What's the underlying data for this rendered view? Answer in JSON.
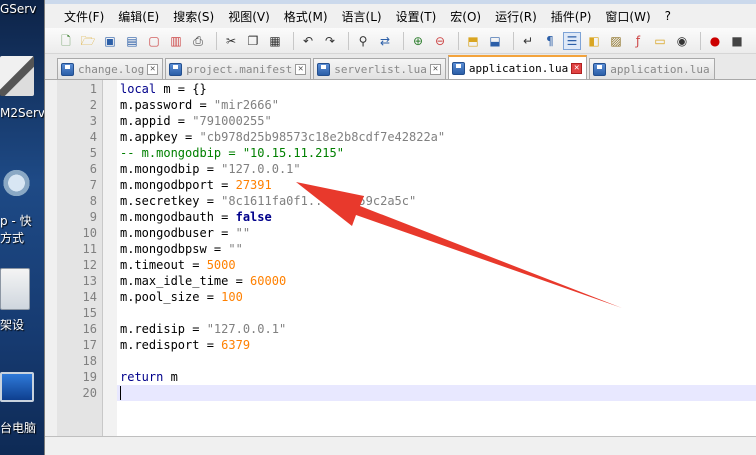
{
  "desktop": {
    "items": [
      {
        "label": "GServ"
      },
      {
        "label": "M2Serv"
      },
      {
        "label": "p - 快"
      },
      {
        "label": "方式"
      },
      {
        "label": "架设"
      },
      {
        "label": "台电脑"
      }
    ]
  },
  "menu": [
    {
      "label": "文件(F)"
    },
    {
      "label": "编辑(E)"
    },
    {
      "label": "搜索(S)"
    },
    {
      "label": "视图(V)"
    },
    {
      "label": "格式(M)"
    },
    {
      "label": "语言(L)"
    },
    {
      "label": "设置(T)"
    },
    {
      "label": "宏(O)"
    },
    {
      "label": "运行(R)"
    },
    {
      "label": "插件(P)"
    },
    {
      "label": "窗口(W)"
    },
    {
      "label": "?"
    }
  ],
  "toolbar": {
    "icons": [
      "new-file",
      "open-file",
      "save",
      "save-all",
      "close",
      "close-all",
      "print",
      "cut",
      "copy",
      "paste",
      "undo",
      "redo",
      "find",
      "replace",
      "zoom-in",
      "zoom-out",
      "sync-vertical",
      "sync-horizontal",
      "word-wrap",
      "show-all-chars",
      "indent-guide",
      "user-lang",
      "doc-map",
      "function-list",
      "monitor",
      "record-macro",
      "stop-record"
    ]
  },
  "tabs": [
    {
      "label": "change.log",
      "active": false
    },
    {
      "label": "project.manifest",
      "active": false
    },
    {
      "label": "serverlist.lua",
      "active": false
    },
    {
      "label": "application.lua",
      "active": true
    },
    {
      "label": "application.lua",
      "active": false
    }
  ],
  "editor": {
    "line_numbers": [
      "1",
      "2",
      "3",
      "4",
      "5",
      "6",
      "7",
      "8",
      "9",
      "10",
      "11",
      "12",
      "13",
      "14",
      "15",
      "16",
      "17",
      "18",
      "19",
      "20"
    ],
    "current_line": 20,
    "lines": [
      [
        {
          "t": "kw",
          "v": "local"
        },
        {
          "t": "plain",
          "v": " m = {}"
        }
      ],
      [
        {
          "t": "plain",
          "v": "m.password = "
        },
        {
          "t": "str",
          "v": "\"mir2666\""
        }
      ],
      [
        {
          "t": "plain",
          "v": "m.appid = "
        },
        {
          "t": "str",
          "v": "\"791000255\""
        }
      ],
      [
        {
          "t": "plain",
          "v": "m.appkey = "
        },
        {
          "t": "str",
          "v": "\"cb978d25b98573c18e2b8cdf7e42822a\""
        }
      ],
      [
        {
          "t": "cmt",
          "v": "-- m.mongodbip = \"10.15.11.215\""
        }
      ],
      [
        {
          "t": "plain",
          "v": "m.mongodbip = "
        },
        {
          "t": "str",
          "v": "\"127.0.0.1\""
        }
      ],
      [
        {
          "t": "plain",
          "v": "m.mongodbport = "
        },
        {
          "t": "num",
          "v": "27391"
        }
      ],
      [
        {
          "t": "plain",
          "v": "m.secretkey = "
        },
        {
          "t": "str",
          "v": "\"8c1611fa0f1...086a59c2a5c\""
        }
      ],
      [
        {
          "t": "plain",
          "v": "m.mongodbauth = "
        },
        {
          "t": "bool",
          "v": "false"
        }
      ],
      [
        {
          "t": "plain",
          "v": "m.mongodbuser = "
        },
        {
          "t": "str",
          "v": "\"\""
        }
      ],
      [
        {
          "t": "plain",
          "v": "m.mongodbpsw = "
        },
        {
          "t": "str",
          "v": "\"\""
        }
      ],
      [
        {
          "t": "plain",
          "v": "m.timeout = "
        },
        {
          "t": "num",
          "v": "5000"
        }
      ],
      [
        {
          "t": "plain",
          "v": "m.max_idle_time = "
        },
        {
          "t": "num",
          "v": "60000"
        }
      ],
      [
        {
          "t": "plain",
          "v": "m.pool_size = "
        },
        {
          "t": "num",
          "v": "100"
        }
      ],
      [],
      [
        {
          "t": "plain",
          "v": "m.redisip = "
        },
        {
          "t": "str",
          "v": "\"127.0.0.1\""
        }
      ],
      [
        {
          "t": "plain",
          "v": "m.redisport = "
        },
        {
          "t": "num",
          "v": "6379"
        }
      ],
      [],
      [
        {
          "t": "kw",
          "v": "return"
        },
        {
          "t": "plain",
          "v": " m"
        }
      ],
      []
    ]
  },
  "colors": {
    "keyword": "#00008b",
    "string": "#808080",
    "number": "#ff8000",
    "comment": "#008000",
    "current_line": "#e8e8ff",
    "annotation_arrow": "#e8392c"
  }
}
